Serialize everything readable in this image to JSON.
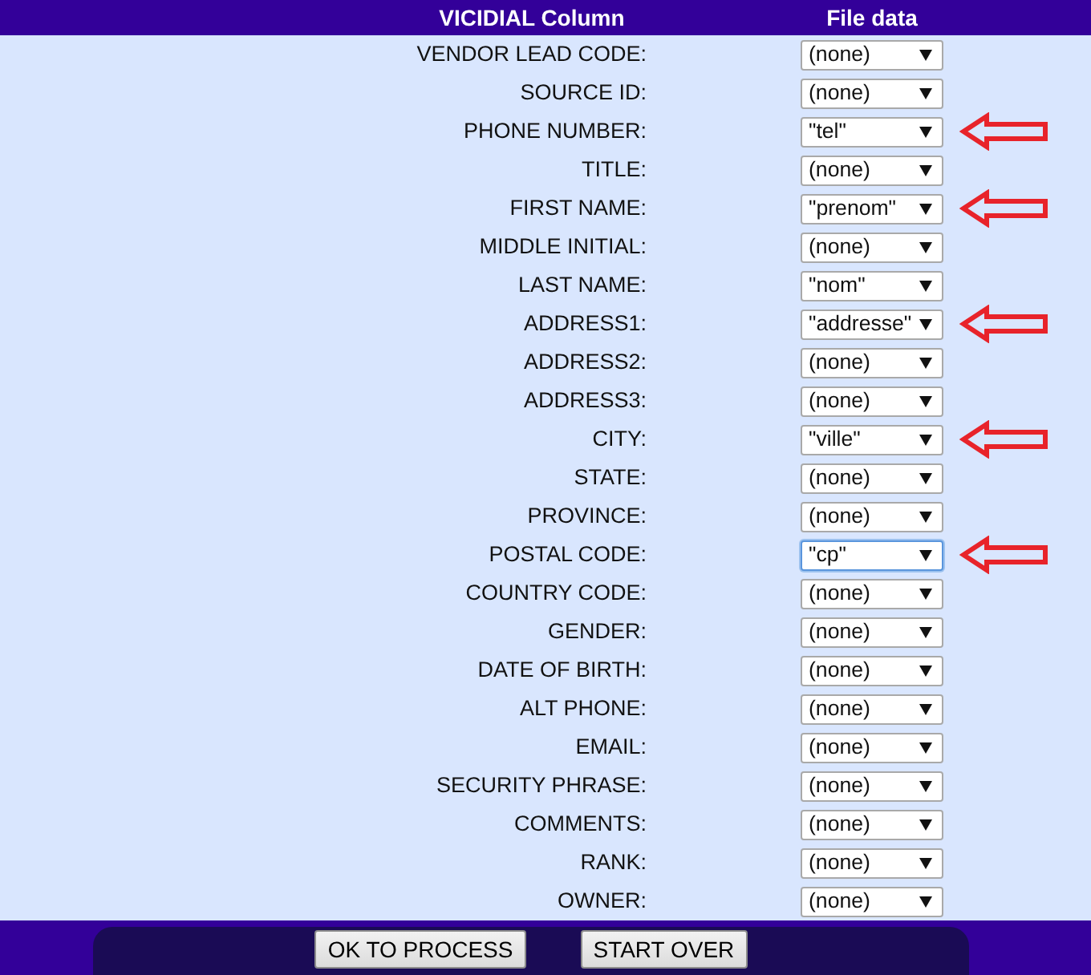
{
  "columns": [
    "VICIDIAL Column",
    "File data"
  ],
  "rows": [
    {
      "label": "VENDOR LEAD CODE:",
      "value": "(none)",
      "focused": false,
      "arrow_marked": false
    },
    {
      "label": "SOURCE ID:",
      "value": "(none)",
      "focused": false,
      "arrow_marked": false
    },
    {
      "label": "PHONE NUMBER:",
      "value": "\"tel\"",
      "focused": false,
      "arrow_marked": true
    },
    {
      "label": "TITLE:",
      "value": "(none)",
      "focused": false,
      "arrow_marked": false
    },
    {
      "label": "FIRST NAME:",
      "value": "\"prenom\"",
      "focused": false,
      "arrow_marked": true
    },
    {
      "label": "MIDDLE INITIAL:",
      "value": "(none)",
      "focused": false,
      "arrow_marked": false
    },
    {
      "label": "LAST NAME:",
      "value": "\"nom\"",
      "focused": false,
      "arrow_marked": false
    },
    {
      "label": "ADDRESS1:",
      "value": "\"addresse\"",
      "focused": false,
      "arrow_marked": true
    },
    {
      "label": "ADDRESS2:",
      "value": "(none)",
      "focused": false,
      "arrow_marked": false
    },
    {
      "label": "ADDRESS3:",
      "value": "(none)",
      "focused": false,
      "arrow_marked": false
    },
    {
      "label": "CITY:",
      "value": "\"ville\"",
      "focused": false,
      "arrow_marked": true
    },
    {
      "label": "STATE:",
      "value": "(none)",
      "focused": false,
      "arrow_marked": false
    },
    {
      "label": "PROVINCE:",
      "value": "(none)",
      "focused": false,
      "arrow_marked": false
    },
    {
      "label": "POSTAL CODE:",
      "value": "\"cp\"",
      "focused": true,
      "arrow_marked": true
    },
    {
      "label": "COUNTRY CODE:",
      "value": "(none)",
      "focused": false,
      "arrow_marked": false
    },
    {
      "label": "GENDER:",
      "value": "(none)",
      "focused": false,
      "arrow_marked": false
    },
    {
      "label": "DATE OF BIRTH:",
      "value": "(none)",
      "focused": false,
      "arrow_marked": false
    },
    {
      "label": "ALT PHONE:",
      "value": "(none)",
      "focused": false,
      "arrow_marked": false
    },
    {
      "label": "EMAIL:",
      "value": "(none)",
      "focused": false,
      "arrow_marked": false
    },
    {
      "label": "SECURITY PHRASE:",
      "value": "(none)",
      "focused": false,
      "arrow_marked": false
    },
    {
      "label": "COMMENTS:",
      "value": "(none)",
      "focused": false,
      "arrow_marked": false
    },
    {
      "label": "RANK:",
      "value": "(none)",
      "focused": false,
      "arrow_marked": false
    },
    {
      "label": "OWNER:",
      "value": "(none)",
      "focused": false,
      "arrow_marked": false
    }
  ],
  "buttons": [
    {
      "label": "OK TO PROCESS"
    },
    {
      "label": "START OVER"
    }
  ]
}
